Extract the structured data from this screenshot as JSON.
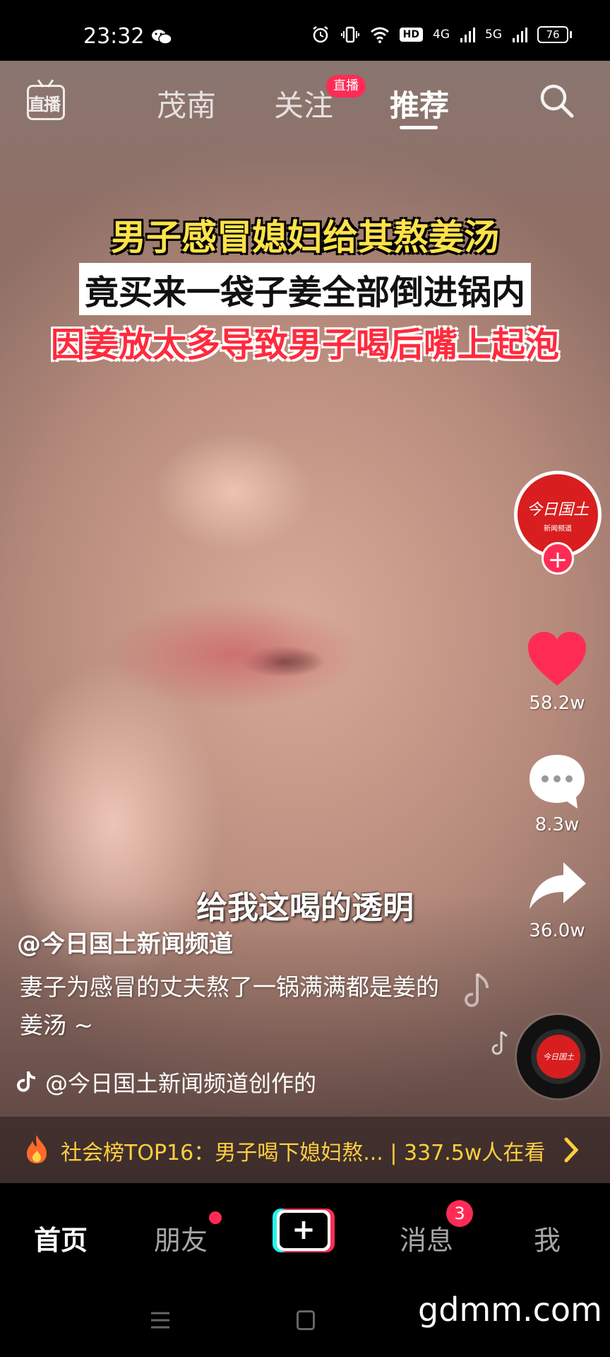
{
  "status_bar": {
    "time": "23:32",
    "network_1": "4G",
    "network_2": "5G",
    "hd_label": "HD",
    "battery": "76"
  },
  "top_nav": {
    "live_label": "直播",
    "tabs": [
      "茂南",
      "关注",
      "推荐"
    ],
    "active_tab": "推荐",
    "follow_live_badge": "直播"
  },
  "video": {
    "caption_line_1": "男子感冒媳妇给其熬姜汤",
    "caption_line_2": "竟买来一袋子姜全部倒进锅内",
    "caption_line_3": "因姜放太多导致男子喝后嘴上起泡",
    "subtitle": "给我这喝的透明"
  },
  "author": {
    "handle": "@今日国土新闻频道",
    "avatar_text": "今日国土",
    "avatar_subtext": "新闻频道"
  },
  "description": "妻子为感冒的丈夫熬了一锅满满都是姜的姜汤 ~",
  "music": {
    "label": "@今日国土新闻频道创作的"
  },
  "actions": {
    "likes": "58.2w",
    "comments": "8.3w",
    "shares": "36.0w"
  },
  "hot_bar": {
    "text": "社会榜TOP16：男子喝下媳妇熬... | 337.5w人在看"
  },
  "bottom_tabs": {
    "home": "首页",
    "friends": "朋友",
    "plus": "+",
    "messages": "消息",
    "messages_badge": "3",
    "me": "我"
  },
  "watermark": "gdmm.com",
  "colors": {
    "accent_pink": "#fe2c55",
    "accent_cyan": "#25f4ee",
    "caption_yellow": "#ffe24a",
    "caption_red": "#ff2a3d",
    "hot_text": "#ffcf3f"
  }
}
